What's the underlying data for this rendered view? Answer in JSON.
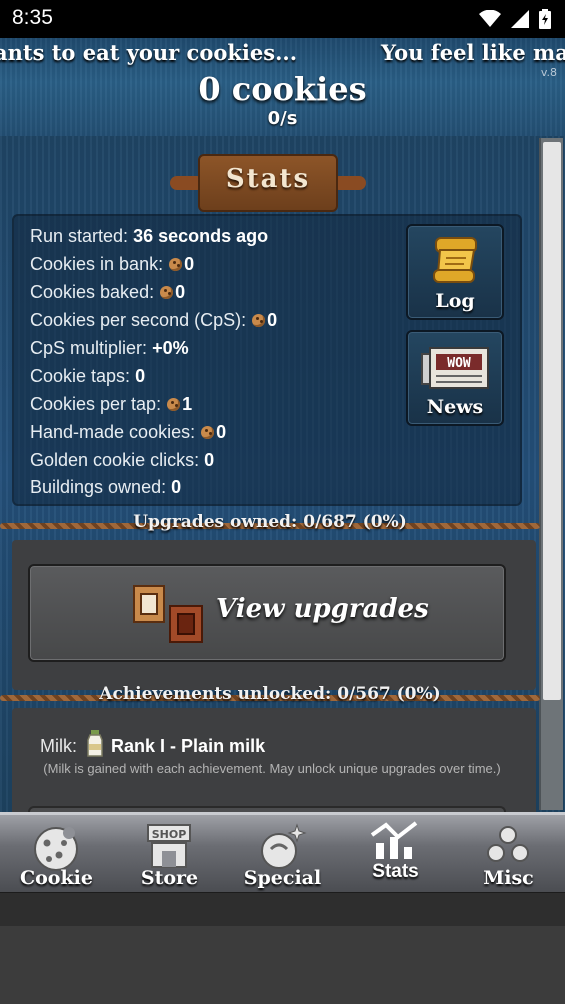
{
  "status_bar": {
    "time": "8:35"
  },
  "header": {
    "ticker_a": "ants to eat your cookies...",
    "ticker_b": "You feel like ma",
    "version": "v.8",
    "cookie_count": "0 cookies",
    "cps": "0/s"
  },
  "stats": {
    "title": "Stats",
    "run_started": {
      "label": "Run started:",
      "value": "36 seconds ago"
    },
    "cookies_in_bank": {
      "label": "Cookies in bank:",
      "value": "0"
    },
    "cookies_baked": {
      "label": "Cookies baked:",
      "value": "0"
    },
    "cps": {
      "label": "Cookies per second (CpS):",
      "value": "0"
    },
    "cps_multiplier": {
      "label": "CpS multiplier:",
      "value": "+0%"
    },
    "cookie_taps": {
      "label": "Cookie taps:",
      "value": "0"
    },
    "cookies_per_tap": {
      "label": "Cookies per tap:",
      "value": "1"
    },
    "hand_made": {
      "label": "Hand-made cookies:",
      "value": "0"
    },
    "golden_clicks": {
      "label": "Golden cookie clicks:",
      "value": "0"
    },
    "buildings_owned": {
      "label": "Buildings owned:",
      "value": "0"
    },
    "log_label": "Log",
    "news_label": "News"
  },
  "upgrades": {
    "owned_text": "Upgrades owned: 0/687 (0%)",
    "view_button": "View upgrades"
  },
  "achievements": {
    "unlocked_text": "Achievements unlocked: 0/567 (0%)",
    "milk_label": "Milk:",
    "milk_rank": "Rank I - Plain milk",
    "milk_note": "(Milk is gained with each achievement. May unlock unique upgrades over time.)"
  },
  "nav": [
    {
      "label": "Cookie",
      "icon": "cookie-icon"
    },
    {
      "label": "Store",
      "icon": "shop-icon",
      "icon_text": "SHOP"
    },
    {
      "label": "Special",
      "icon": "special-icon"
    },
    {
      "label": "Stats",
      "icon": "stats-icon",
      "active": true
    },
    {
      "label": "Misc",
      "icon": "misc-icon"
    }
  ]
}
